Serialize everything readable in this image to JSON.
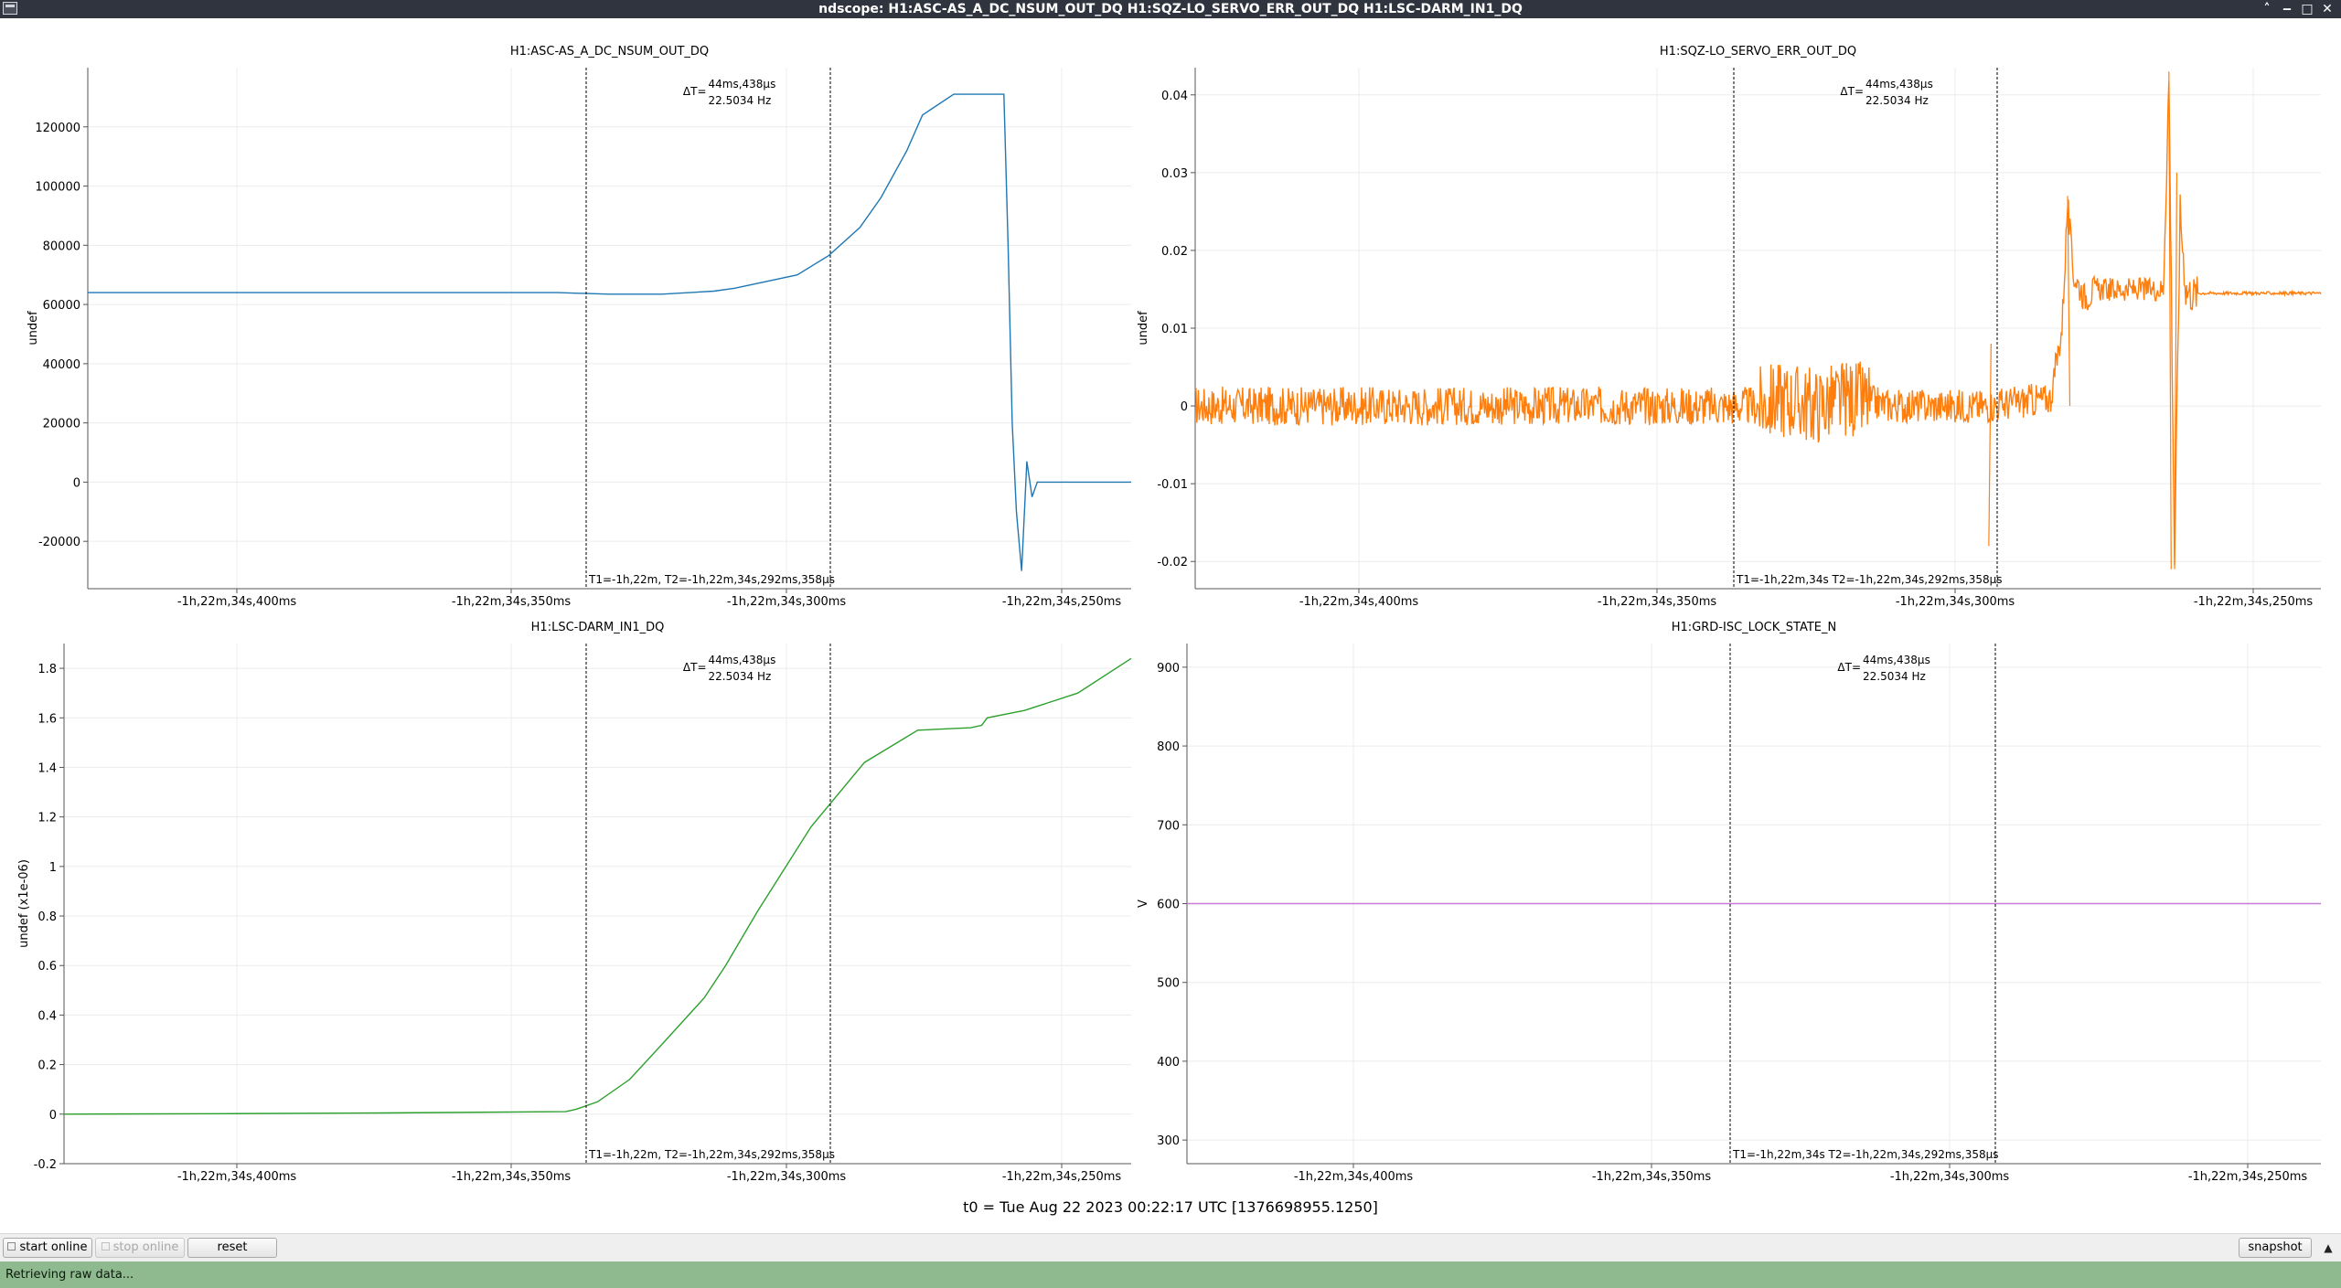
{
  "window": {
    "title": "ndscope: H1:ASC-AS_A_DC_NSUM_OUT_DQ H1:SQZ-LO_SERVO_ERR_OUT_DQ H1:LSC-DARM_IN1_DQ",
    "buttons": [
      "chevron-up-icon",
      "minimize-icon",
      "maximize-icon",
      "close-icon"
    ]
  },
  "chart_data": [
    {
      "type": "line",
      "title": "H1:ASC-AS_A_DC_NSUM_OUT_DQ",
      "ylabel": "undef",
      "color": "#1f77b4",
      "ylim": [
        -36000,
        140000
      ],
      "yticks": [
        "120000",
        "100000",
        "80000",
        "60000",
        "40000",
        "20000",
        "0",
        "-20000"
      ],
      "xticks": [
        "-1h,22m,34s,400ms",
        "-1h,22m,34s,350ms",
        "-1h,22m,34s,300ms",
        "-1h,22m,34s,250ms"
      ],
      "cursor": {
        "delta_label": "ΔT=",
        "delta_time": "44ms,438µs",
        "delta_freq": "22.5034 Hz",
        "t_label": "T1=-1h,22m, T2=-1h,22m,34s,292ms,358µs"
      },
      "series": [
        {
          "x": [
            0.0,
            0.2,
            0.4,
            0.45,
            0.5,
            0.55,
            0.6,
            0.62,
            0.68,
            0.71,
            0.74,
            0.76,
            0.785,
            0.8,
            0.83,
            0.85,
            0.878,
            0.882,
            0.886,
            0.89,
            0.895,
            0.9,
            0.905,
            0.91,
            0.92,
            0.95,
            1.0
          ],
          "values": [
            64000,
            64000,
            64000,
            64000,
            63500,
            63500,
            64500,
            65500,
            70000,
            76500,
            86000,
            96000,
            112000,
            124000,
            131000,
            131000,
            131000,
            80000,
            20000,
            -10000,
            -30000,
            7000,
            -5000,
            0,
            0,
            0,
            0
          ]
        }
      ]
    },
    {
      "type": "line",
      "title": "H1:SQZ-LO_SERVO_ERR_OUT_DQ",
      "ylabel": "undef",
      "color": "#ff7f0e",
      "ylim": [
        -0.0235,
        0.0435
      ],
      "yticks": [
        "0.04",
        "0.03",
        "0.02",
        "0.01",
        "0",
        "-0.01",
        "-0.02"
      ],
      "xticks": [
        "-1h,22m,34s,400ms",
        "-1h,22m,34s,350ms",
        "-1h,22m,34s,300ms",
        "-1h,22m,34s,250ms"
      ],
      "cursor": {
        "delta_label": "ΔT=",
        "delta_time": "44ms,438µs",
        "delta_freq": "22.5034 Hz",
        "t_label": "T1=-1h,22m,34s T2=-1h,22m,34s,292ms,358µs"
      },
      "series": [
        {
          "x": [
            0.0,
            0.5,
            0.52,
            0.55,
            0.58,
            0.62,
            0.68,
            0.7,
            0.705,
            0.76,
            0.77,
            0.775,
            0.78,
            0.79,
            0.8,
            0.84,
            0.86,
            0.865,
            0.87,
            0.875,
            0.88,
            0.885,
            0.89,
            1.0
          ],
          "values": [
            0.0,
            0.0,
            0.001,
            0.0,
            0.001,
            0.0,
            0.0,
            0.0,
            0.0,
            0.001,
            0.01,
            0.026,
            0.017,
            0.014,
            0.015,
            0.015,
            0.015,
            0.042,
            -0.02,
            0.025,
            0.015,
            0.0145,
            0.0145,
            0.0145
          ]
        }
      ]
    },
    {
      "type": "line",
      "title": "H1:LSC-DARM_IN1_DQ",
      "ylabel": "undef (x1e-06)",
      "color": "#2ca02c",
      "ylim": [
        -0.2,
        1.9
      ],
      "yticks": [
        "1.8",
        "1.6",
        "1.4",
        "1.2",
        "1",
        "0.8",
        "0.6",
        "0.4",
        "0.2",
        "0",
        "-0.2"
      ],
      "xticks": [
        "-1h,22m,34s,400ms",
        "-1h,22m,34s,350ms",
        "-1h,22m,34s,300ms",
        "-1h,22m,34s,250ms"
      ],
      "cursor": {
        "delta_label": "ΔT=",
        "delta_time": "44ms,438µs",
        "delta_freq": "22.5034 Hz",
        "t_label": "T1=-1h,22m, T2=-1h,22m,34s,292ms,358µs"
      },
      "series": [
        {
          "x": [
            0.0,
            0.15,
            0.3,
            0.47,
            0.48,
            0.5,
            0.53,
            0.56,
            0.6,
            0.62,
            0.65,
            0.7,
            0.75,
            0.8,
            0.85,
            0.86,
            0.865,
            0.9,
            0.95,
            1.0
          ],
          "values": [
            0.0,
            0.002,
            0.005,
            0.01,
            0.02,
            0.05,
            0.14,
            0.28,
            0.47,
            0.6,
            0.82,
            1.16,
            1.42,
            1.55,
            1.56,
            1.57,
            1.6,
            1.63,
            1.7,
            1.84
          ]
        }
      ]
    },
    {
      "type": "line",
      "title": "H1:GRD-ISC_LOCK_STATE_N",
      "ylabel": "V",
      "color": "#c77ad6",
      "ylim": [
        270,
        930
      ],
      "yticks": [
        "900",
        "800",
        "700",
        "600",
        "500",
        "400",
        "300"
      ],
      "xticks": [
        "-1h,22m,34s,400ms",
        "-1h,22m,34s,350ms",
        "-1h,22m,34s,300ms",
        "-1h,22m,34s,250ms"
      ],
      "cursor": {
        "delta_label": "ΔT=",
        "delta_time": "44ms,438µs",
        "delta_freq": "22.5034 Hz",
        "t_label": "T1=-1h,22m,34s T2=-1h,22m,34s,292ms,358µs"
      },
      "series": [
        {
          "x": [
            0.0,
            1.0
          ],
          "values": [
            600,
            600
          ]
        }
      ]
    }
  ],
  "footer": {
    "t0": "t0 = Tue Aug 22 2023 00:22:17 UTC [1376698955.1250]"
  },
  "controls": {
    "start_online": "start online",
    "stop_online": "stop online",
    "reset": "reset",
    "snapshot": "snapshot"
  },
  "status": {
    "message": "Retrieving raw data..."
  }
}
